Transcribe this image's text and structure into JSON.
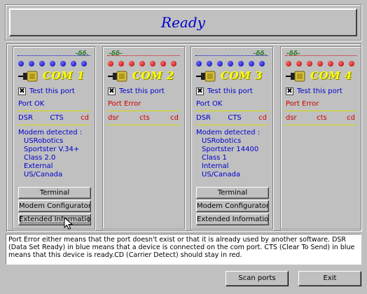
{
  "title": "Ready",
  "test_label": "Test this port",
  "test_check": "✖",
  "modem_heading": "Modem detected :",
  "buttons": {
    "terminal": "Terminal",
    "configurator": "Modem Configurator",
    "extended": "Extended Information"
  },
  "ports": [
    {
      "name": "COM 1",
      "handshake": "-δδ.",
      "status": "Port OK",
      "status_kind": "ok",
      "leds": "blue",
      "signals": {
        "dsr": "DSR",
        "cts": "CTS",
        "cd": "cd"
      },
      "modem": [
        "USRobotics",
        "Sportster V.34+",
        "Class 2.0",
        "External",
        "US/Canada"
      ]
    },
    {
      "name": "COM 2",
      "handshake": "-δδ-",
      "status": "Port Error",
      "status_kind": "error",
      "leds": "red",
      "signals": {
        "dsr": "dsr",
        "cts": "cts",
        "cd": "cd"
      },
      "modem": []
    },
    {
      "name": "COM 3",
      "handshake": "-δδ.",
      "status": "Port OK",
      "status_kind": "ok",
      "leds": "blue",
      "signals": {
        "dsr": "DSR",
        "cts": "CTS",
        "cd": "cd"
      },
      "modem": [
        "USRobotics",
        "Sportster 14400",
        "Class 1",
        "Internal",
        "US/Canada"
      ]
    },
    {
      "name": "COM 4",
      "handshake": "-δδ-",
      "status": "Port Error",
      "status_kind": "error",
      "leds": "red",
      "signals": {
        "dsr": "dsr",
        "cts": "cts",
        "cd": "cd"
      },
      "modem": []
    }
  ],
  "info_text": "Port Error either means that the port doesn't exist or that it is already used by another software. DSR (Data Set Ready) in blue means that a device is connected on the com port. CTS (Clear To Send) in blue means that this device is ready.CD (Carrier Detect) should stay in red.",
  "scan_button": "Scan ports",
  "exit_button": "Exit",
  "colors": {
    "ok": "#0000cc",
    "error": "#cc0000",
    "com_label": "#ffff00",
    "background": "#c0c0c0"
  }
}
